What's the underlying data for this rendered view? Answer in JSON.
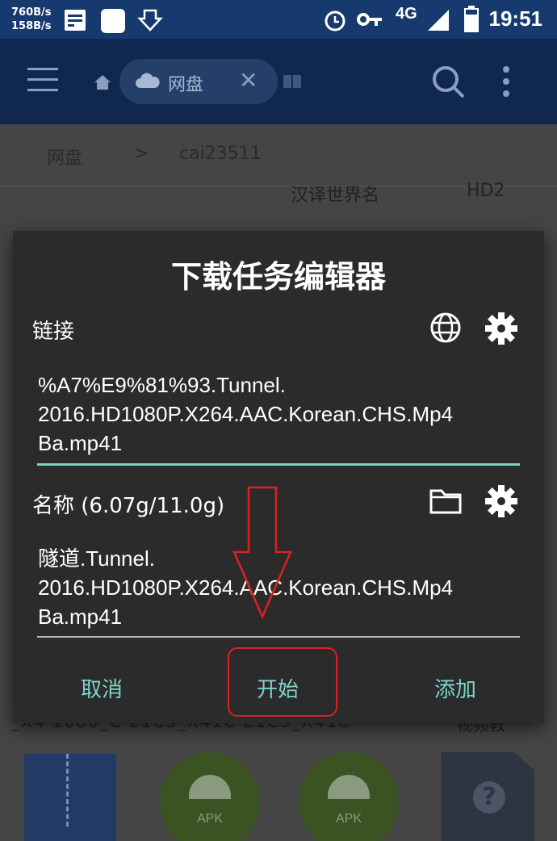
{
  "status_bar": {
    "net_down": "760B/s",
    "net_up": "158B/s",
    "network": "4G",
    "time": "19:51",
    "icons": [
      "sim-card-icon",
      "app-square-icon",
      "download-icon",
      "alarm-icon",
      "key-icon",
      "signal-icon",
      "battery-icon"
    ]
  },
  "app_bar": {
    "tab_label": "网盘",
    "icons": [
      "menu-icon",
      "home-icon",
      "cloud-icon",
      "close-icon",
      "book-icon",
      "search-icon",
      "more-icon"
    ]
  },
  "breadcrumb": {
    "root": "网盘",
    "separator": ">",
    "current": "cai23511"
  },
  "background_content": {
    "row1_text": "汉译世界名",
    "row1_tag": "HD2",
    "row2_text": "_X4 1080_C  E1C3_X41C  E1C3_X41C",
    "row2_tag": "视频教",
    "apk_label": "APK",
    "unknown_label": "?"
  },
  "dialog": {
    "title": "下载任务编辑器",
    "link_label": "链接",
    "link_value": "%A7%E9%81%93.Tunnel.\n2016.HD1080P.X264.AAC.Korean.CHS.Mp4\nBa.mp41",
    "name_label": "名称 (6.07g/11.0g)",
    "name_value": "隧道.Tunnel.\n2016.HD1080P.X264.AAC.Korean.CHS.Mp4\nBa.mp41",
    "cancel_label": "取消",
    "start_label": "开始",
    "add_label": "添加"
  },
  "colors": {
    "accent": "#7fd3c8",
    "dialog_bg": "#2b2b2b",
    "appbar": "#10284f",
    "annotation": "#e02020"
  }
}
